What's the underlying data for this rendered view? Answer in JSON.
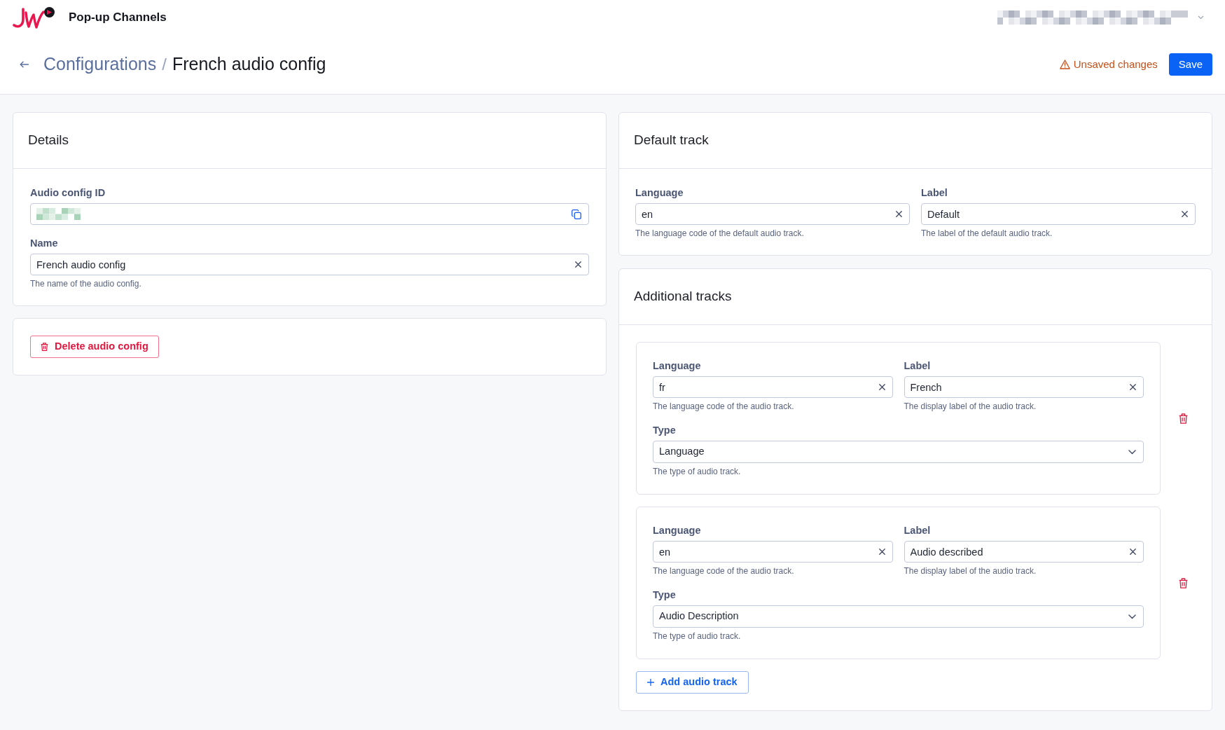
{
  "app_bar": {
    "app_name": "Pop-up Channels"
  },
  "breadcrumb": {
    "parent": "Configurations",
    "separator": "/",
    "current": "French audio config"
  },
  "status": "Unsaved changes",
  "save_button": "Save",
  "details": {
    "title": "Details",
    "fields": [
      {
        "kind": "copy",
        "label": "Audio config ID"
      },
      {
        "kind": "text",
        "label": "Name",
        "value": "French audio config",
        "help": "The name of the audio config."
      }
    ]
  },
  "delete_button": "Delete audio config",
  "default_track": {
    "title": "Default track",
    "fields": [
      {
        "kind": "text",
        "label": "Language",
        "value": "en",
        "help": "The language code of the default audio track."
      },
      {
        "kind": "text",
        "label": "Label",
        "value": "Default",
        "help": "The label of the default audio track."
      }
    ]
  },
  "additional_tracks": {
    "title": "Additional tracks",
    "tracks": [
      {
        "fields": [
          {
            "kind": "text",
            "label": "Language",
            "value": "fr",
            "help": "The language code of the audio track."
          },
          {
            "kind": "text",
            "label": "Label",
            "value": "French",
            "help": "The display label of the audio track."
          },
          {
            "kind": "select",
            "label": "Type",
            "value": "Language",
            "help": "The type of audio track."
          }
        ]
      },
      {
        "fields": [
          {
            "kind": "text",
            "label": "Language",
            "value": "en",
            "help": "The language code of the audio track."
          },
          {
            "kind": "text",
            "label": "Label",
            "value": "Audio described",
            "help": "The display label of the audio track."
          },
          {
            "kind": "select",
            "label": "Type",
            "value": "Audio Description",
            "help": "The type of audio track."
          }
        ]
      }
    ],
    "add_button": "Add audio track"
  }
}
